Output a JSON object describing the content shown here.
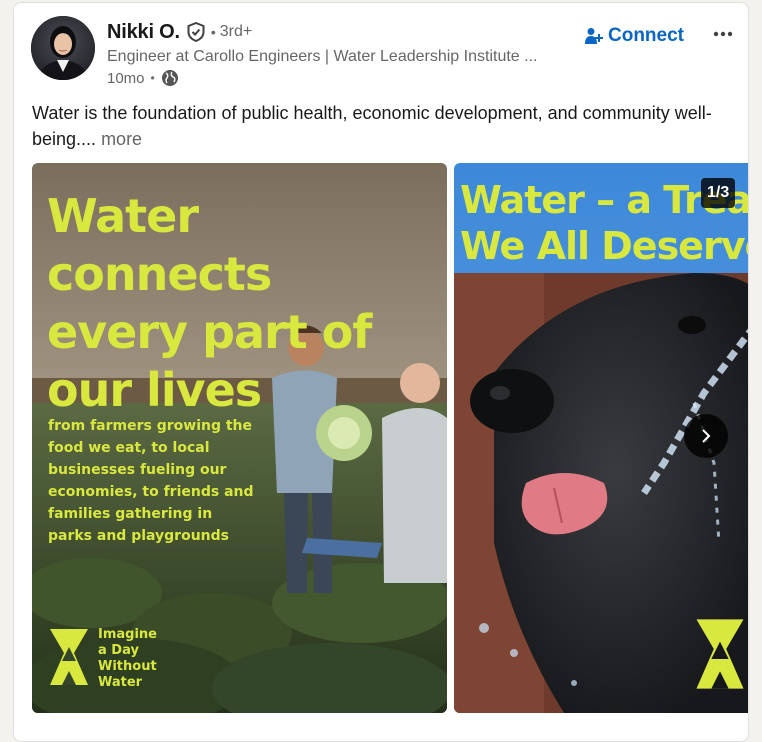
{
  "post": {
    "author": {
      "name": "Nikki O.",
      "degree": "3rd+",
      "headline": "Engineer at Carollo Engineers | Water Leadership Institute ...",
      "time": "10mo",
      "visibility_icon": "globe-icon",
      "verified_icon": "verified-shield-icon"
    },
    "actions": {
      "connect_label": "Connect",
      "connect_icon": "person-add-icon",
      "more_icon": "overflow-menu-icon"
    },
    "text": "Water is the foundation of public health, economic development, and community well-being....",
    "see_more_label": "more"
  },
  "carousel": {
    "counter": "1/3",
    "next_icon": "chevron-right-icon",
    "slides": [
      {
        "headline_lines": [
          "Water",
          "connects",
          "every part of",
          "our lives"
        ],
        "body": "from farmers growing the food we eat, to local businesses fueling our economies, to friends and families gathering in parks and playgrounds",
        "logo_lines": [
          "Imagine",
          "a Day",
          "Without",
          "Water"
        ]
      },
      {
        "headline_lines": [
          "Water – a Treat",
          "We All Deserve"
        ]
      }
    ]
  },
  "colors": {
    "accent_blue": "#0a66c2",
    "brand_yellow": "#d9e83e",
    "muted_text": "#666666"
  }
}
